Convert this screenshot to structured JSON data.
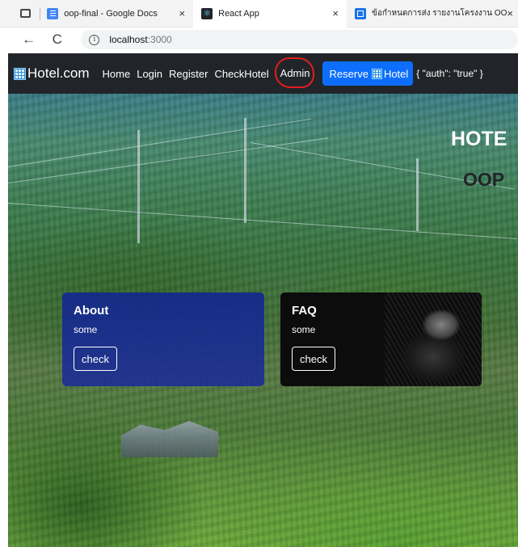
{
  "browser": {
    "tabs": [
      {
        "title": "oop-final - Google Docs",
        "icon": "google-docs-icon"
      },
      {
        "title": "React App",
        "icon": "react-icon"
      },
      {
        "title": "ข้อกำหนดการส่ง รายงานโครงงาน OO",
        "icon": "page-icon"
      }
    ],
    "tab_close": "×",
    "address": {
      "host": "localhost",
      "port": ":3000"
    },
    "back_icon": "←",
    "reload_icon": "C",
    "info_icon": "i"
  },
  "navbar": {
    "brand": "Hotel.com",
    "links": [
      "Home",
      "Login",
      "Register",
      "CheckHotel",
      "Admin"
    ],
    "reserve_button": {
      "text_before": "Reserve",
      "text_after": "Hotel"
    },
    "auth_json": "{ \"auth\": \"true\" }",
    "highlight_color": "#e21e1e",
    "bg_color": "#212529",
    "button_color": "#0d6efd"
  },
  "hero": {
    "title_visible": "HOTE",
    "subtitle_visible": "OOP"
  },
  "cards": [
    {
      "title": "About",
      "text": "some",
      "button": "check"
    },
    {
      "title": "FAQ",
      "text": "some",
      "button": "check"
    }
  ]
}
